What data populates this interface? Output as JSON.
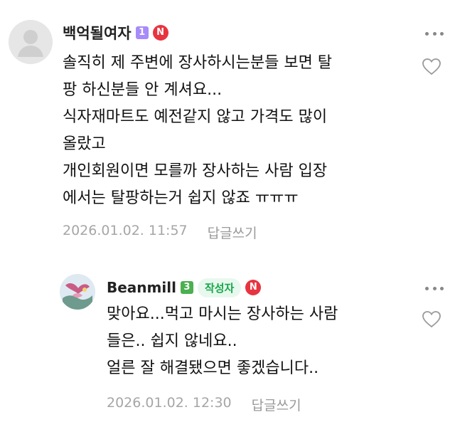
{
  "comments": [
    {
      "username": "백억될여자",
      "level": "1",
      "n_badge": "N",
      "lines": [
        "솔직히 제 주변에 장사하시는분들 보면 탈",
        "팡 하신분들 안 계셔요...",
        "식자재마트도 예전같지 않고 가격도 많이",
        "올랐고",
        "개인회원이면 모를까 장사하는 사람 입장",
        "에서는 탈팡하는거 쉽지 않죠 ㅠㅠㅠ"
      ],
      "timestamp": "2026.01.02. 11:57",
      "reply_label": "답글쓰기"
    },
    {
      "username": "Beanmill",
      "level": "3",
      "author_tag": "작성자",
      "n_badge": "N",
      "lines": [
        "맞아요...먹고 마시는 장사하는 사람",
        "들은.. 쉽지 않네요..",
        "얼른 잘 해결됐으면 좋겠습니다.."
      ],
      "timestamp": "2026.01.02. 12:30",
      "reply_label": "답글쓰기"
    }
  ],
  "icons": {
    "more": "more-icon",
    "heart": "heart-icon",
    "default_avatar": "default-avatar-icon"
  },
  "colors": {
    "level1_badge": "#a78bfa",
    "level3_badge": "#4caf50",
    "n_badge": "#e7343f",
    "author_tag_bg": "#e8f8ee",
    "author_tag_text": "#17a84a",
    "meta_text": "#a6a6a6"
  }
}
